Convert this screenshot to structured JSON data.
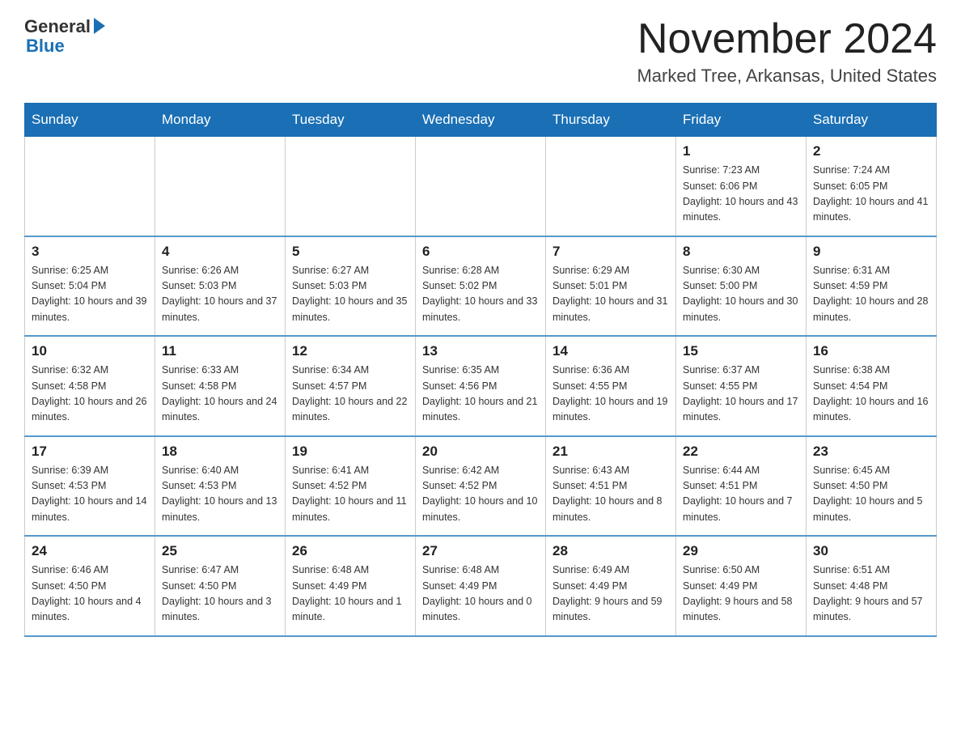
{
  "header": {
    "logo_general": "General",
    "logo_blue": "Blue",
    "month_title": "November 2024",
    "location": "Marked Tree, Arkansas, United States"
  },
  "days_of_week": [
    "Sunday",
    "Monday",
    "Tuesday",
    "Wednesday",
    "Thursday",
    "Friday",
    "Saturday"
  ],
  "weeks": [
    {
      "days": [
        {
          "number": "",
          "info": ""
        },
        {
          "number": "",
          "info": ""
        },
        {
          "number": "",
          "info": ""
        },
        {
          "number": "",
          "info": ""
        },
        {
          "number": "",
          "info": ""
        },
        {
          "number": "1",
          "info": "Sunrise: 7:23 AM\nSunset: 6:06 PM\nDaylight: 10 hours and 43 minutes."
        },
        {
          "number": "2",
          "info": "Sunrise: 7:24 AM\nSunset: 6:05 PM\nDaylight: 10 hours and 41 minutes."
        }
      ]
    },
    {
      "days": [
        {
          "number": "3",
          "info": "Sunrise: 6:25 AM\nSunset: 5:04 PM\nDaylight: 10 hours and 39 minutes."
        },
        {
          "number": "4",
          "info": "Sunrise: 6:26 AM\nSunset: 5:03 PM\nDaylight: 10 hours and 37 minutes."
        },
        {
          "number": "5",
          "info": "Sunrise: 6:27 AM\nSunset: 5:03 PM\nDaylight: 10 hours and 35 minutes."
        },
        {
          "number": "6",
          "info": "Sunrise: 6:28 AM\nSunset: 5:02 PM\nDaylight: 10 hours and 33 minutes."
        },
        {
          "number": "7",
          "info": "Sunrise: 6:29 AM\nSunset: 5:01 PM\nDaylight: 10 hours and 31 minutes."
        },
        {
          "number": "8",
          "info": "Sunrise: 6:30 AM\nSunset: 5:00 PM\nDaylight: 10 hours and 30 minutes."
        },
        {
          "number": "9",
          "info": "Sunrise: 6:31 AM\nSunset: 4:59 PM\nDaylight: 10 hours and 28 minutes."
        }
      ]
    },
    {
      "days": [
        {
          "number": "10",
          "info": "Sunrise: 6:32 AM\nSunset: 4:58 PM\nDaylight: 10 hours and 26 minutes."
        },
        {
          "number": "11",
          "info": "Sunrise: 6:33 AM\nSunset: 4:58 PM\nDaylight: 10 hours and 24 minutes."
        },
        {
          "number": "12",
          "info": "Sunrise: 6:34 AM\nSunset: 4:57 PM\nDaylight: 10 hours and 22 minutes."
        },
        {
          "number": "13",
          "info": "Sunrise: 6:35 AM\nSunset: 4:56 PM\nDaylight: 10 hours and 21 minutes."
        },
        {
          "number": "14",
          "info": "Sunrise: 6:36 AM\nSunset: 4:55 PM\nDaylight: 10 hours and 19 minutes."
        },
        {
          "number": "15",
          "info": "Sunrise: 6:37 AM\nSunset: 4:55 PM\nDaylight: 10 hours and 17 minutes."
        },
        {
          "number": "16",
          "info": "Sunrise: 6:38 AM\nSunset: 4:54 PM\nDaylight: 10 hours and 16 minutes."
        }
      ]
    },
    {
      "days": [
        {
          "number": "17",
          "info": "Sunrise: 6:39 AM\nSunset: 4:53 PM\nDaylight: 10 hours and 14 minutes."
        },
        {
          "number": "18",
          "info": "Sunrise: 6:40 AM\nSunset: 4:53 PM\nDaylight: 10 hours and 13 minutes."
        },
        {
          "number": "19",
          "info": "Sunrise: 6:41 AM\nSunset: 4:52 PM\nDaylight: 10 hours and 11 minutes."
        },
        {
          "number": "20",
          "info": "Sunrise: 6:42 AM\nSunset: 4:52 PM\nDaylight: 10 hours and 10 minutes."
        },
        {
          "number": "21",
          "info": "Sunrise: 6:43 AM\nSunset: 4:51 PM\nDaylight: 10 hours and 8 minutes."
        },
        {
          "number": "22",
          "info": "Sunrise: 6:44 AM\nSunset: 4:51 PM\nDaylight: 10 hours and 7 minutes."
        },
        {
          "number": "23",
          "info": "Sunrise: 6:45 AM\nSunset: 4:50 PM\nDaylight: 10 hours and 5 minutes."
        }
      ]
    },
    {
      "days": [
        {
          "number": "24",
          "info": "Sunrise: 6:46 AM\nSunset: 4:50 PM\nDaylight: 10 hours and 4 minutes."
        },
        {
          "number": "25",
          "info": "Sunrise: 6:47 AM\nSunset: 4:50 PM\nDaylight: 10 hours and 3 minutes."
        },
        {
          "number": "26",
          "info": "Sunrise: 6:48 AM\nSunset: 4:49 PM\nDaylight: 10 hours and 1 minute."
        },
        {
          "number": "27",
          "info": "Sunrise: 6:48 AM\nSunset: 4:49 PM\nDaylight: 10 hours and 0 minutes."
        },
        {
          "number": "28",
          "info": "Sunrise: 6:49 AM\nSunset: 4:49 PM\nDaylight: 9 hours and 59 minutes."
        },
        {
          "number": "29",
          "info": "Sunrise: 6:50 AM\nSunset: 4:49 PM\nDaylight: 9 hours and 58 minutes."
        },
        {
          "number": "30",
          "info": "Sunrise: 6:51 AM\nSunset: 4:48 PM\nDaylight: 9 hours and 57 minutes."
        }
      ]
    }
  ]
}
